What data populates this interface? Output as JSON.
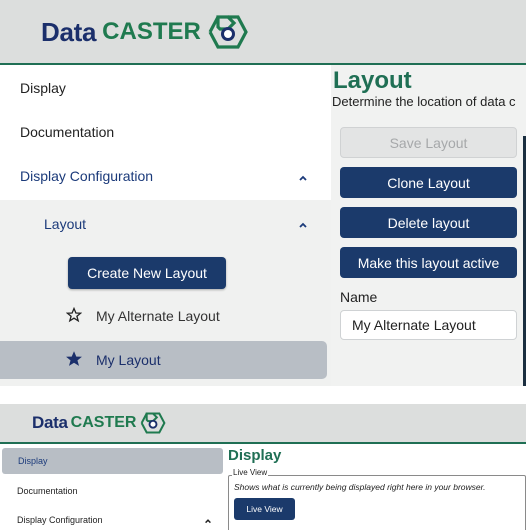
{
  "top": {
    "logo": {
      "data": "Data",
      "caster": "CASTER"
    },
    "sidebar": {
      "items": [
        {
          "label": "Display"
        },
        {
          "label": "Documentation"
        },
        {
          "label": "Display Configuration"
        },
        {
          "label": "Layout"
        }
      ],
      "create_button": "Create New Layout",
      "layouts": [
        {
          "label": "My Alternate Layout",
          "active": false
        },
        {
          "label": "My Layout",
          "active": true
        }
      ]
    },
    "main": {
      "title": "Layout",
      "subtitle": "Determine the location of data c",
      "buttons": {
        "save": "Save Layout",
        "clone": "Clone Layout",
        "delete": "Delete layout",
        "activate": "Make this layout active"
      },
      "name_label": "Name",
      "name_value": "My Alternate Layout"
    }
  },
  "bottom": {
    "logo": {
      "data": "Data",
      "caster": "CASTER"
    },
    "sidebar": {
      "items": [
        {
          "label": "Display"
        },
        {
          "label": "Documentation"
        },
        {
          "label": "Display Configuration"
        }
      ]
    },
    "main": {
      "title": "Display",
      "fieldset_legend": "Live View",
      "fieldset_desc": "Shows what is currently being displayed right here in your browser.",
      "live_button": "Live View"
    }
  },
  "colors": {
    "brand_navy": "#1b2f6b",
    "brand_green": "#1f7a4f",
    "button_navy": "#1b3a6b",
    "selected_bg": "#b8bec5",
    "header_bg": "#dcdedd"
  }
}
